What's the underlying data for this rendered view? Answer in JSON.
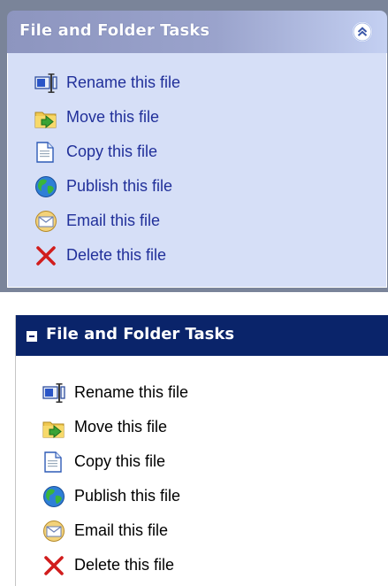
{
  "panels": [
    {
      "title": "File and Folder Tasks",
      "style": "xp-luna",
      "colors": {
        "header": "#8d95bf",
        "body": "#d6dff7",
        "outer": "#7a8499",
        "text": "#21309a"
      },
      "items": [
        {
          "label": "Rename this file",
          "icon": "rename-icon"
        },
        {
          "label": "Move this file",
          "icon": "move-icon"
        },
        {
          "label": "Copy this file",
          "icon": "copy-icon"
        },
        {
          "label": "Publish this file",
          "icon": "publish-icon"
        },
        {
          "label": "Email this file",
          "icon": "email-icon"
        },
        {
          "label": "Delete this file",
          "icon": "delete-icon"
        }
      ]
    },
    {
      "title": "File and Folder Tasks",
      "style": "classic",
      "colors": {
        "header": "#0a246a",
        "body": "#ffffff",
        "text": "#000000"
      },
      "items": [
        {
          "label": "Rename this file",
          "icon": "rename-icon"
        },
        {
          "label": "Move this file",
          "icon": "move-icon"
        },
        {
          "label": "Copy this file",
          "icon": "copy-icon"
        },
        {
          "label": "Publish this file",
          "icon": "publish-icon"
        },
        {
          "label": "Email this file",
          "icon": "email-icon"
        },
        {
          "label": "Delete this file",
          "icon": "delete-icon"
        }
      ]
    }
  ]
}
